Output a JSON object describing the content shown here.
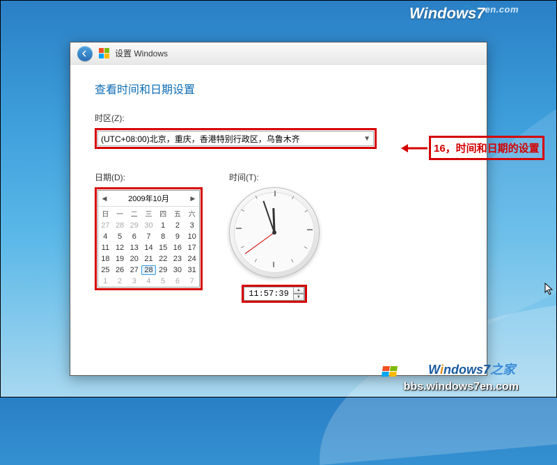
{
  "overlay": {
    "top_logo_main": "Windows7",
    "top_logo_suffix": "en.com",
    "bottom_logo": "Windows7之家",
    "bottom_url": "bbs.windows7en.com"
  },
  "window": {
    "title": "设置 Windows",
    "heading": "查看时间和日期设置"
  },
  "timezone": {
    "label": "时区(Z):",
    "value": "(UTC+08:00)北京，重庆，香港特别行政区，乌鲁木齐"
  },
  "date": {
    "label": "日期(D):",
    "month": "2009年10月",
    "dayheaders": [
      "日",
      "一",
      "二",
      "三",
      "四",
      "五",
      "六"
    ],
    "weeks": [
      [
        {
          "d": "27",
          "g": true
        },
        {
          "d": "28",
          "g": true
        },
        {
          "d": "29",
          "g": true
        },
        {
          "d": "30",
          "g": true
        },
        {
          "d": "1"
        },
        {
          "d": "2"
        },
        {
          "d": "3"
        }
      ],
      [
        {
          "d": "4"
        },
        {
          "d": "5"
        },
        {
          "d": "6"
        },
        {
          "d": "7"
        },
        {
          "d": "8"
        },
        {
          "d": "9"
        },
        {
          "d": "10"
        }
      ],
      [
        {
          "d": "11"
        },
        {
          "d": "12"
        },
        {
          "d": "13"
        },
        {
          "d": "14"
        },
        {
          "d": "15"
        },
        {
          "d": "16"
        },
        {
          "d": "17"
        }
      ],
      [
        {
          "d": "18"
        },
        {
          "d": "19"
        },
        {
          "d": "20"
        },
        {
          "d": "21"
        },
        {
          "d": "22"
        },
        {
          "d": "23"
        },
        {
          "d": "24"
        }
      ],
      [
        {
          "d": "25"
        },
        {
          "d": "26"
        },
        {
          "d": "27"
        },
        {
          "d": "28",
          "sel": true
        },
        {
          "d": "29"
        },
        {
          "d": "30"
        },
        {
          "d": "31"
        }
      ],
      [
        {
          "d": "1",
          "g": true
        },
        {
          "d": "2",
          "g": true
        },
        {
          "d": "3",
          "g": true
        },
        {
          "d": "4",
          "g": true
        },
        {
          "d": "5",
          "g": true
        },
        {
          "d": "6",
          "g": true
        },
        {
          "d": "7",
          "g": true
        }
      ]
    ]
  },
  "time": {
    "label": "时间(T):",
    "value": "11:57:39"
  },
  "annotation": {
    "text": "16，时间和日期的设置"
  }
}
